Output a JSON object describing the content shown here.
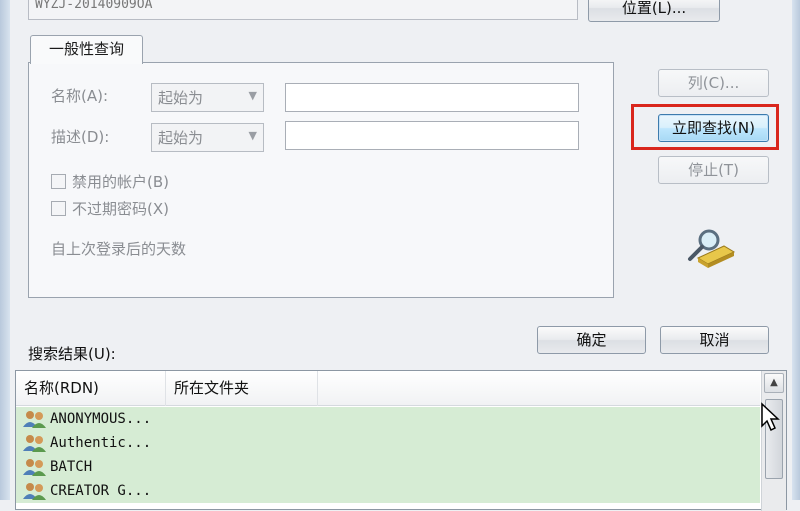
{
  "top": {
    "location_value": "WYZJ-20140909OA",
    "locations_button": "位置(L)..."
  },
  "tab": {
    "label": "一般性查询"
  },
  "query": {
    "name_label": "名称(A):",
    "name_mode": "起始为",
    "name_value": "",
    "desc_label": "描述(D):",
    "desc_mode": "起始为",
    "desc_value": "",
    "disabled_accounts": "禁用的帐户(B)",
    "non_expiring_pw": "不过期密码(X)",
    "days_since_logon": "自上次登录后的天数"
  },
  "buttons": {
    "columns": "列(C)...",
    "find_now": "立即查找(N)",
    "stop": "停止(T)",
    "ok": "确定",
    "cancel": "取消"
  },
  "results": {
    "label": "搜索结果(U):",
    "columns": [
      "名称(RDN)",
      "所在文件夹"
    ],
    "rows": [
      "ANONYMOUS...",
      "Authentic...",
      "BATCH",
      "CREATOR G..."
    ]
  },
  "icons": {
    "search": "magnifier-folder-icon",
    "user_group": "user-group-icon"
  },
  "colors": {
    "highlight": "#d9261c",
    "row_selected": "#d6ecd4",
    "focus_button": "#3d7bad"
  }
}
